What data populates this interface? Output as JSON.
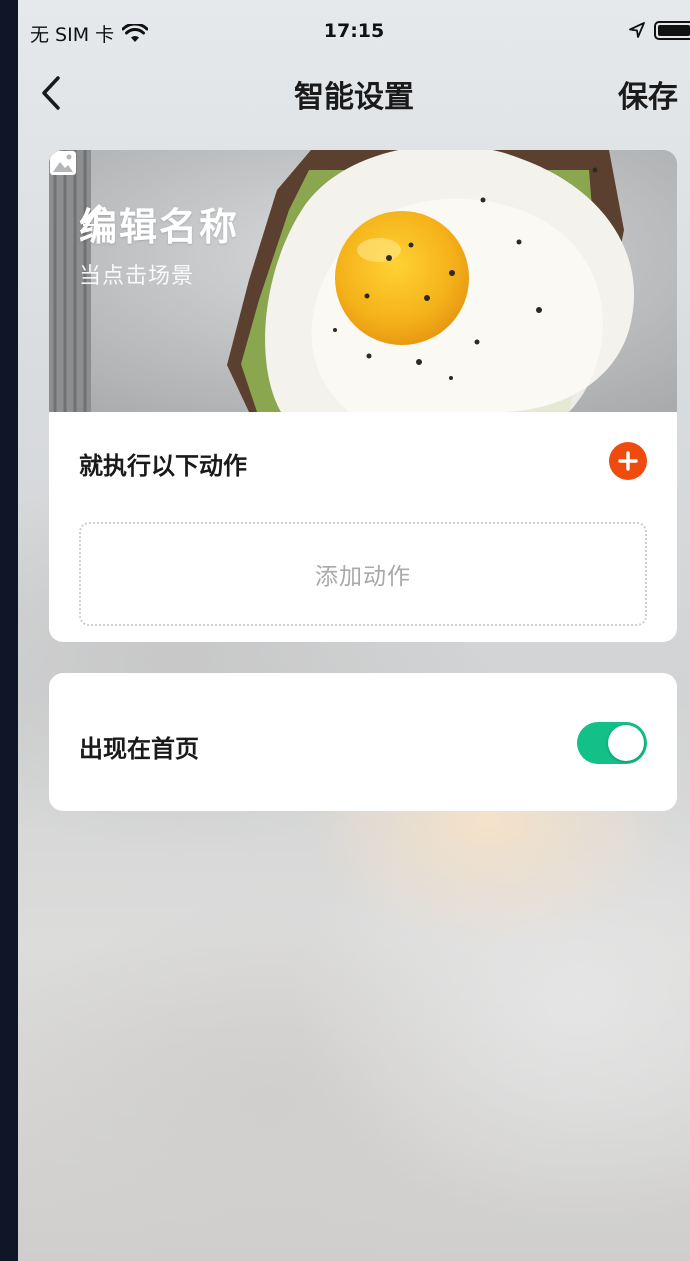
{
  "status_bar": {
    "carrier": "无 SIM 卡",
    "time": "17:15"
  },
  "nav": {
    "title": "智能设置",
    "save_label": "保存",
    "back_icon": "chevron-left-icon"
  },
  "scene": {
    "name": "编辑名称",
    "trigger": "当点击场景",
    "edit_icon": "pencil-icon",
    "image_icon": "image-icon"
  },
  "actions": {
    "section_label": "就执行以下动作",
    "add_icon": "plus-circle-icon",
    "empty_placeholder": "添加动作"
  },
  "home_setting": {
    "label": "出现在首页",
    "enabled": true
  },
  "colors": {
    "accent_orange": "#f04a0f",
    "toggle_on": "#13c088"
  }
}
